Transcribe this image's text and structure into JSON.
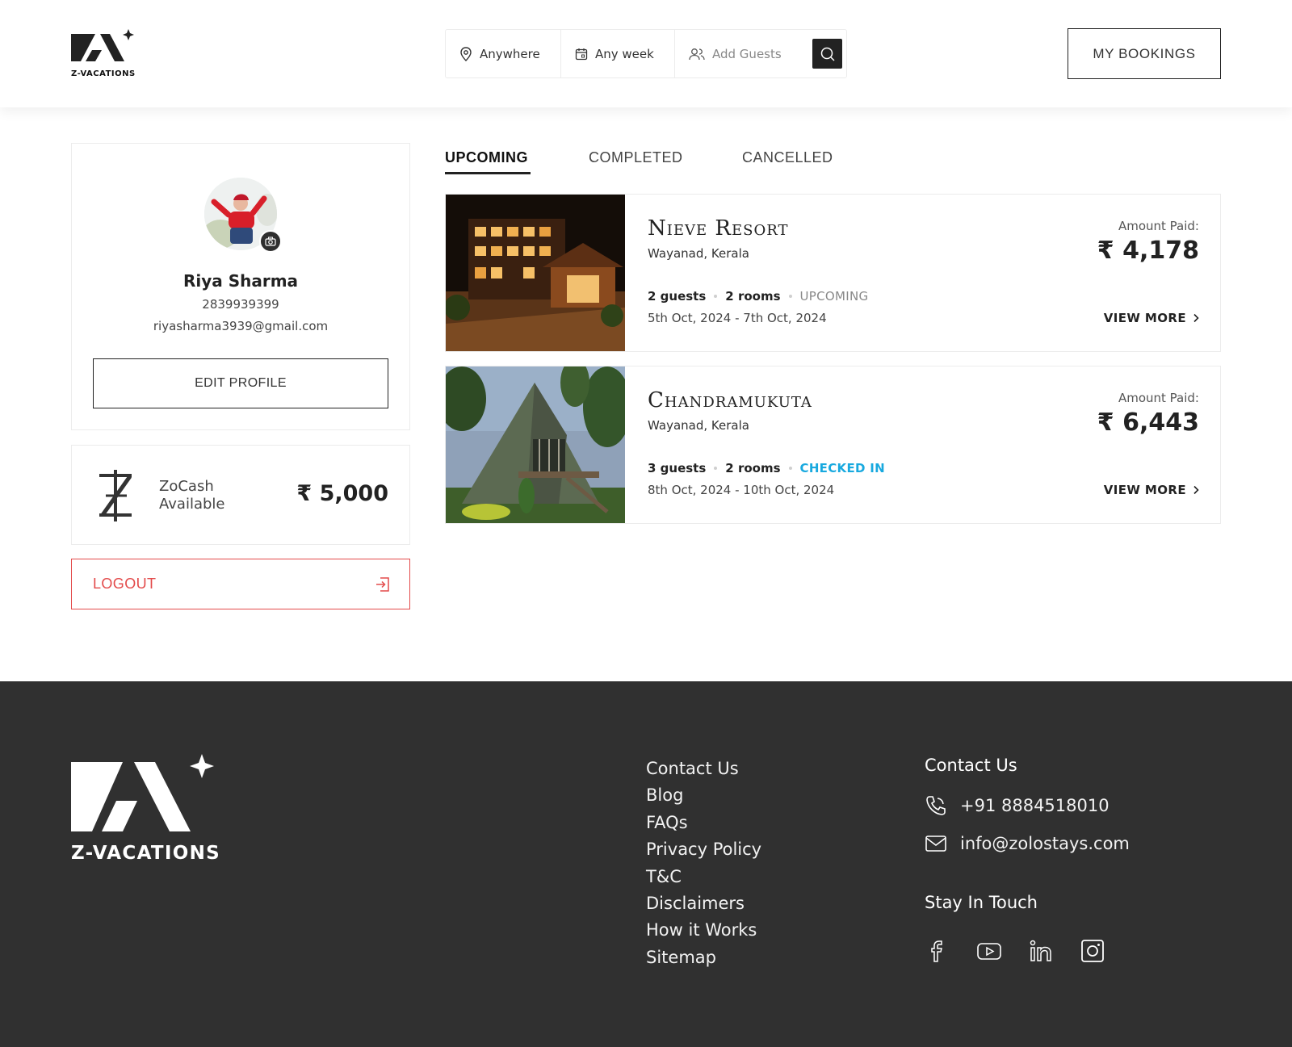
{
  "brand": {
    "name": "Z-VACATIONS"
  },
  "search": {
    "location": "Anywhere",
    "dates": "Any week",
    "guests_placeholder": "Add Guests"
  },
  "header": {
    "my_bookings_label": "MY BOOKINGS"
  },
  "profile": {
    "name": "Riya Sharma",
    "phone": "2839939399",
    "email": "riyasharma3939@gmail.com",
    "edit_label": "EDIT PROFILE"
  },
  "zocash": {
    "label": "ZoCash Available",
    "amount": "₹ 5,000"
  },
  "logout_label": "LOGOUT",
  "tabs": [
    {
      "label": "UPCOMING",
      "active": true
    },
    {
      "label": "COMPLETED",
      "active": false
    },
    {
      "label": "CANCELLED",
      "active": false
    }
  ],
  "bookings": [
    {
      "name": "Nieve Resort",
      "location": "Wayanad, Kerala",
      "guests": "2 guests",
      "rooms": "2 rooms",
      "status": "UPCOMING",
      "dates": "5th Oct, 2024 - 7th Oct, 2024",
      "amount_label": "Amount Paid:",
      "amount": "₹ 4,178",
      "view_more": "VIEW MORE"
    },
    {
      "name": "Chandramukuta",
      "location": "Wayanad, Kerala",
      "guests": "3 guests",
      "rooms": "2 rooms",
      "status": "CHECKED IN",
      "dates": "8th Oct, 2024 - 10th Oct, 2024",
      "amount_label": "Amount Paid:",
      "amount": "₹ 6,443",
      "view_more": "VIEW MORE"
    }
  ],
  "footer": {
    "links": [
      "Contact Us",
      "Blog",
      "FAQs",
      "Privacy Policy",
      "T&C",
      "Disclaimers",
      "How it Works",
      "Sitemap"
    ],
    "contact_heading": "Contact Us",
    "phone": "+91 8884518010",
    "email": "info@zolostays.com",
    "stay_heading": "Stay In Touch",
    "socials": [
      "facebook-icon",
      "youtube-icon",
      "linkedin-icon",
      "instagram-icon"
    ]
  },
  "colors": {
    "accent_dark": "#222222",
    "logout_red": "#e34a4a",
    "checked_in_blue": "#18a9df",
    "footer_bg": "#303030"
  }
}
